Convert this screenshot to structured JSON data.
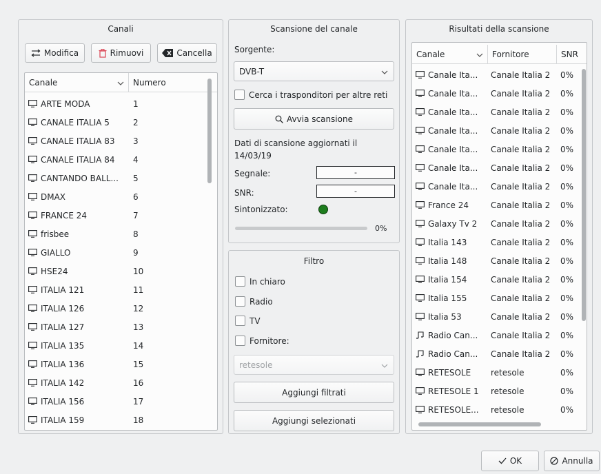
{
  "channels_panel": {
    "title": "Canali",
    "buttons": {
      "edit": "Modifica",
      "remove": "Rimuovi",
      "clear": "Cancella"
    },
    "columns": {
      "channel": "Canale",
      "number": "Numero"
    },
    "rows": [
      {
        "name": "ARTE MODA",
        "number": "1"
      },
      {
        "name": "CANALE ITALIA 5",
        "number": "2"
      },
      {
        "name": "CANALE ITALIA 83",
        "number": "3"
      },
      {
        "name": "CANALE ITALIA 84",
        "number": "4"
      },
      {
        "name": "CANTANDO BALL...",
        "number": "5"
      },
      {
        "name": "DMAX",
        "number": "6"
      },
      {
        "name": "FRANCE 24",
        "number": "7"
      },
      {
        "name": "frisbee",
        "number": "8"
      },
      {
        "name": "GIALLO",
        "number": "9"
      },
      {
        "name": "HSE24",
        "number": "10"
      },
      {
        "name": "ITALIA 121",
        "number": "11"
      },
      {
        "name": "ITALIA 126",
        "number": "12"
      },
      {
        "name": "ITALIA 127",
        "number": "13"
      },
      {
        "name": "ITALIA 135",
        "number": "14"
      },
      {
        "name": "ITALIA 136",
        "number": "15"
      },
      {
        "name": "ITALIA 142",
        "number": "16"
      },
      {
        "name": "ITALIA 156",
        "number": "17"
      },
      {
        "name": "ITALIA 159",
        "number": "18"
      }
    ]
  },
  "scan_panel": {
    "title": "Scansione del canale",
    "source_label": "Sorgente:",
    "source_value": "DVB-T",
    "search_transponders": "Cerca i trasponditori per altre reti",
    "start_scan": "Avvia scansione",
    "scan_info_line1": "Dati di scansione aggiornati il",
    "scan_info_line2": "14/03/19",
    "signal_label": "Segnale:",
    "signal_value": "-",
    "snr_label": "SNR:",
    "snr_value": "-",
    "tuned_label": "Sintonizzato:",
    "progress_text": "0%",
    "progress_value": 0,
    "tuned_color": "#1e7d1e"
  },
  "filter_panel": {
    "title": "Filtro",
    "free": "In chiaro",
    "radio": "Radio",
    "tv": "TV",
    "provider": "Fornitore:",
    "provider_value": "retesole",
    "add_filtered": "Aggiungi filtrati",
    "add_selected": "Aggiungi selezionati"
  },
  "results_panel": {
    "title": "Risultati della scansione",
    "columns": {
      "channel": "Canale",
      "provider": "Fornitore",
      "snr": "SNR"
    },
    "rows": [
      {
        "icon": "tv",
        "name": "Canale Ita...",
        "provider": "Canale Italia 2",
        "snr": "0%"
      },
      {
        "icon": "tv",
        "name": "Canale Ita...",
        "provider": "Canale Italia 2",
        "snr": "0%"
      },
      {
        "icon": "tv",
        "name": "Canale Ita...",
        "provider": "Canale Italia 2",
        "snr": "0%"
      },
      {
        "icon": "tv",
        "name": "Canale Ita...",
        "provider": "Canale Italia 2",
        "snr": "0%"
      },
      {
        "icon": "tv",
        "name": "Canale Ita...",
        "provider": "Canale Italia 2",
        "snr": "0%"
      },
      {
        "icon": "tv",
        "name": "Canale Ita...",
        "provider": "Canale Italia 2",
        "snr": "0%"
      },
      {
        "icon": "tv",
        "name": "Canale Ita...",
        "provider": "Canale Italia 2",
        "snr": "0%"
      },
      {
        "icon": "tv",
        "name": "France 24",
        "provider": "Canale Italia 2",
        "snr": "0%"
      },
      {
        "icon": "tv",
        "name": "Galaxy Tv 2",
        "provider": "Canale Italia 2",
        "snr": "0%"
      },
      {
        "icon": "tv",
        "name": "Italia 143",
        "provider": "Canale Italia 2",
        "snr": "0%"
      },
      {
        "icon": "tv",
        "name": "Italia 148",
        "provider": "Canale Italia 2",
        "snr": "0%"
      },
      {
        "icon": "tv",
        "name": "Italia 154",
        "provider": "Canale Italia 2",
        "snr": "0%"
      },
      {
        "icon": "tv",
        "name": "Italia 155",
        "provider": "Canale Italia 2",
        "snr": "0%"
      },
      {
        "icon": "tv",
        "name": "Italia 53",
        "provider": "Canale Italia 2",
        "snr": "0%"
      },
      {
        "icon": "music",
        "name": "Radio Can...",
        "provider": "Canale Italia 2",
        "snr": "0%"
      },
      {
        "icon": "music",
        "name": "Radio Can...",
        "provider": "Canale Italia 2",
        "snr": "0%"
      },
      {
        "icon": "tv",
        "name": "RETESOLE",
        "provider": "retesole",
        "snr": "0%"
      },
      {
        "icon": "tv",
        "name": "RETESOLE 1",
        "provider": "retesole",
        "snr": "0%"
      },
      {
        "icon": "tv",
        "name": "RETESOLE...",
        "provider": "retesole",
        "snr": "0%"
      }
    ]
  },
  "dialog_buttons": {
    "ok": "OK",
    "cancel": "Annulla"
  },
  "colors": {
    "remove_icon": "#da4453",
    "background": "#eff0f1"
  }
}
